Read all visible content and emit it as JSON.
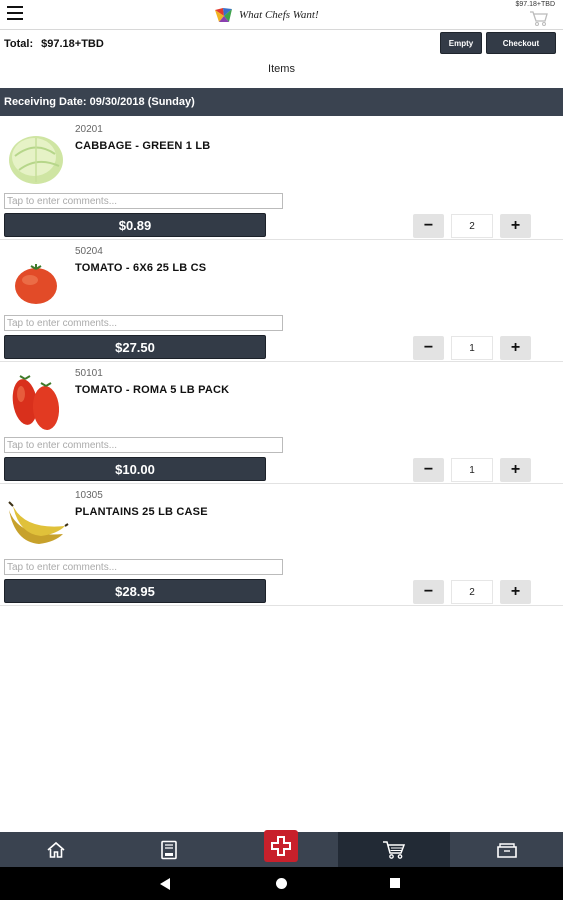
{
  "header": {
    "logo_text": "What Chefs Want!",
    "cart_amount": "$97.18+TBD"
  },
  "summary": {
    "total_label": "Total:",
    "total_value": "$97.18+TBD",
    "empty_label": "Empty",
    "checkout_label": "Checkout"
  },
  "section_title": "Items",
  "receiving_date": "Receiving Date: 09/30/2018 (Sunday)",
  "items": [
    {
      "code": "20201",
      "name": "CABBAGE - GREEN 1 LB",
      "comment_placeholder": "Tap to enter comments...",
      "price": "$0.89",
      "qty": "2",
      "image": "cabbage"
    },
    {
      "code": "50204",
      "name": "TOMATO - 6X6 25 LB CS",
      "comment_placeholder": "Tap to enter comments...",
      "price": "$27.50",
      "qty": "1",
      "image": "tomato"
    },
    {
      "code": "50101",
      "name": "TOMATO - ROMA 5 LB PACK",
      "comment_placeholder": "Tap to enter comments...",
      "price": "$10.00",
      "qty": "1",
      "image": "roma-tomato"
    },
    {
      "code": "10305",
      "name": "PLANTAINS 25 LB CASE",
      "comment_placeholder": "Tap to enter comments...",
      "price": "$28.95",
      "qty": "2",
      "image": "plantains"
    }
  ],
  "stepper": {
    "minus": "−",
    "plus": "+"
  },
  "bottom_nav": [
    {
      "icon": "home-icon"
    },
    {
      "icon": "catalog-icon"
    },
    {
      "icon": "add-icon"
    },
    {
      "icon": "cart-icon",
      "active": true
    },
    {
      "icon": "orders-icon"
    }
  ],
  "colors": {
    "primary": "#333b47",
    "accent": "#c8202b",
    "nav": "#3a4350"
  }
}
